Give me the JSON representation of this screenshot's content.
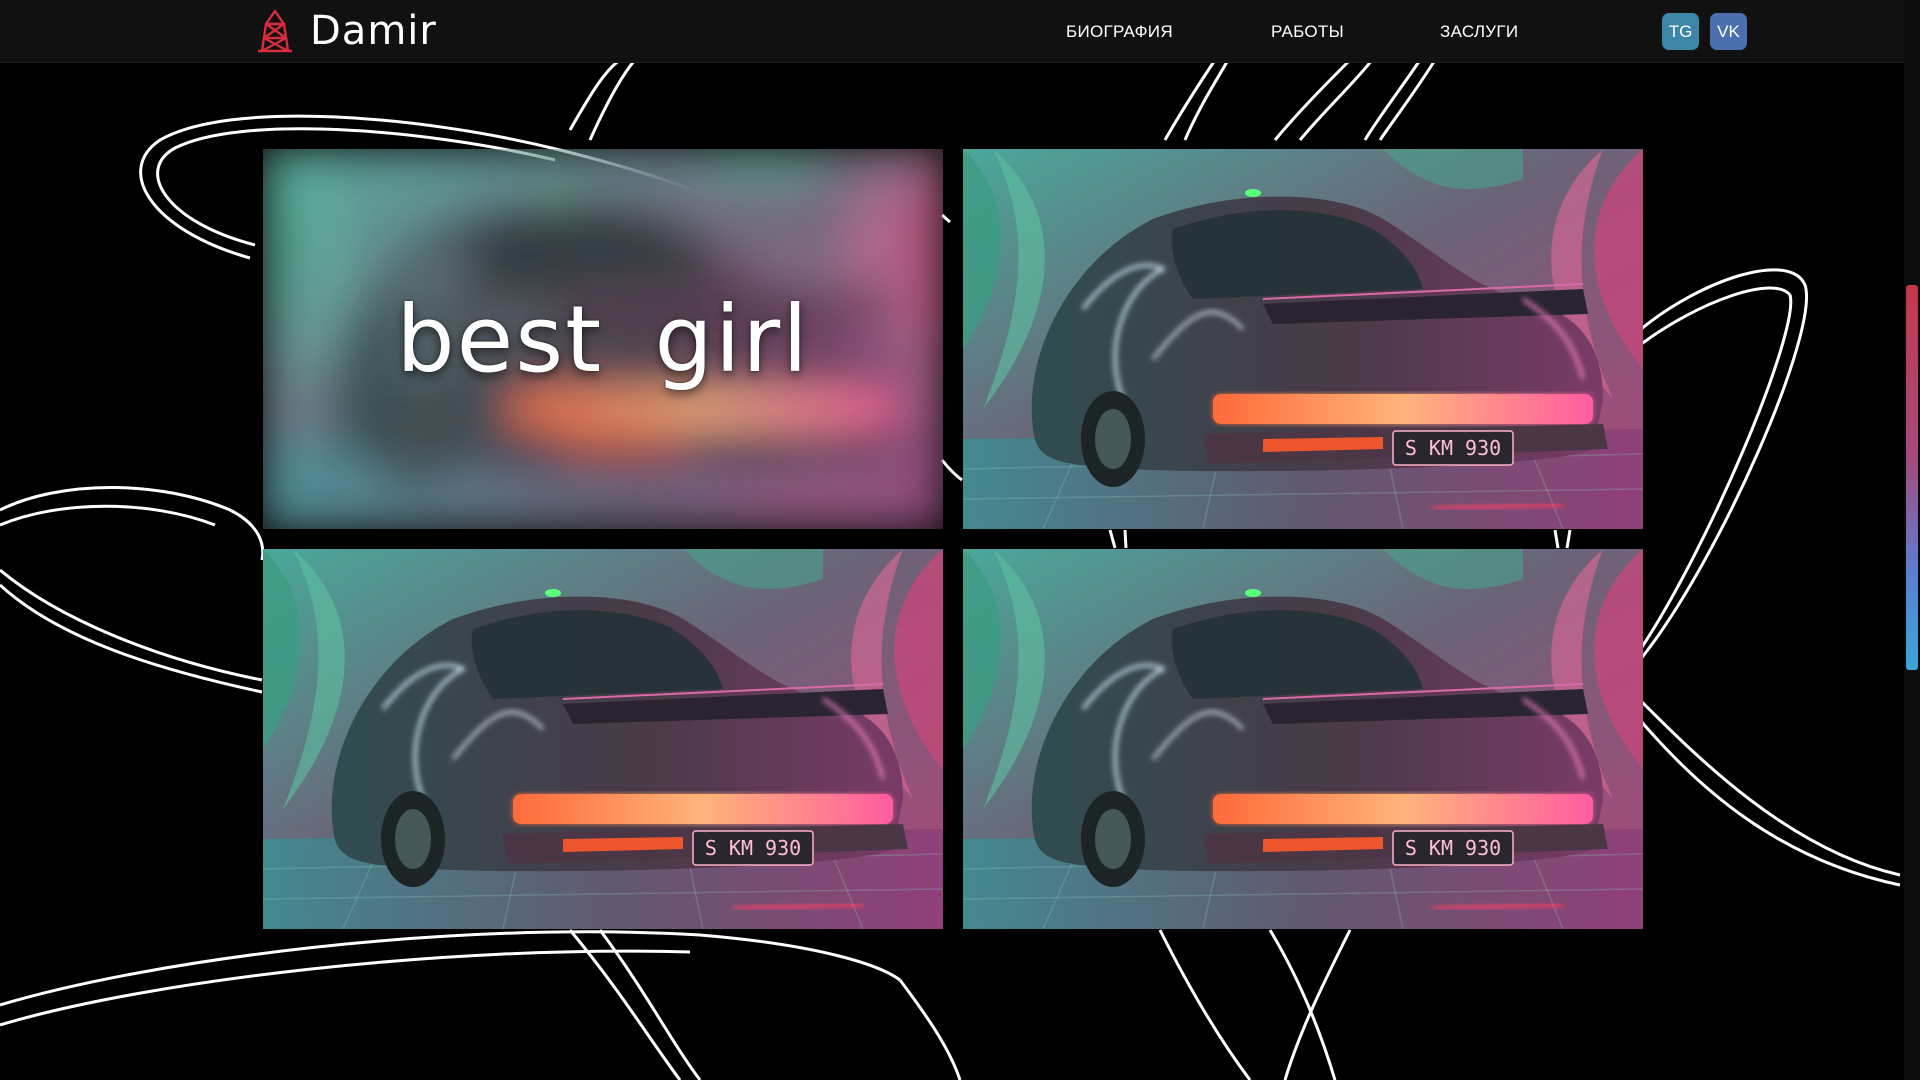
{
  "header": {
    "logo_text": "Damir",
    "nav": [
      {
        "label": "БИОГРАФИЯ"
      },
      {
        "label": "РАБОТЫ"
      },
      {
        "label": "ЗАСЛУГИ"
      }
    ],
    "social": [
      {
        "label": "TG",
        "color": "#3c86a8"
      },
      {
        "label": "VK",
        "color": "#4c6faf"
      }
    ]
  },
  "gallery": {
    "items": [
      {
        "caption": "best girl",
        "style": "blurred",
        "plate": ""
      },
      {
        "caption": "",
        "style": "image",
        "plate": "S KM 930"
      },
      {
        "caption": "",
        "style": "image",
        "plate": "S KM 930"
      },
      {
        "caption": "",
        "style": "image",
        "plate": "S KM 930"
      }
    ]
  },
  "theme": {
    "background": "#000000",
    "header_bg": "#111112",
    "logo_accent": "#d62c3b",
    "curve_color": "#ffffff"
  }
}
